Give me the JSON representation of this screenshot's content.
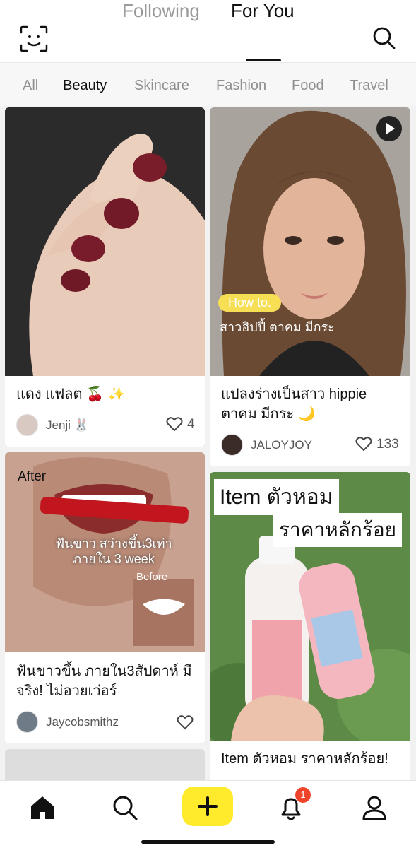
{
  "header": {
    "tabs": [
      {
        "label": "Following",
        "active": false
      },
      {
        "label": "For You",
        "active": true
      }
    ],
    "left_icon": "face-scan-icon",
    "right_icon": "search-icon"
  },
  "categories": [
    {
      "label": "All",
      "active": false
    },
    {
      "label": "Beauty",
      "active": true
    },
    {
      "label": "Skincare",
      "active": false
    },
    {
      "label": "Fashion",
      "active": false
    },
    {
      "label": "Food",
      "active": false
    },
    {
      "label": "Travel",
      "active": false
    }
  ],
  "feed": {
    "cards": [
      {
        "title": "แดง แฟลต 🍒 ✨",
        "author": "Jenji 🐰",
        "likes": "4",
        "thumb_color": "#d7b8a7"
      },
      {
        "title": "แปลงร่างเป็นสาว hippie ตาคม มีกระ 🌙",
        "author": "JALOYJOY",
        "likes": "133",
        "overlay_pill": "How to.",
        "overlay_text": "สาวฮิปปี้ ตาคม มีกระ",
        "thumb_color": "#7e5a44",
        "video": true
      },
      {
        "title": "ฟันขาวขึ้น ภายใน3สัปดาห์ มีจริง! ไม่อวยเว่อร์",
        "author": "Jaycobsmithz",
        "likes": "",
        "overlay_after": "After",
        "overlay_before": "Before",
        "overlay_text": "ฟันขาว สว่างขึ้น3เท่า ภายใน 3 week",
        "thumb_color": "#b78b7a"
      },
      {
        "title": "Item ตัวหอม ราคาหลักร้อย!",
        "overlay_line1": "Item ตัวหอม",
        "overlay_line2": "ราคาหลักร้อย",
        "thumb_color": "#6f9a57"
      }
    ]
  },
  "bottom_nav": {
    "items": [
      "home-icon",
      "search-icon",
      "create-plus-icon",
      "bell-icon",
      "profile-icon"
    ],
    "notification_count": "1",
    "accent": "#ffea2b"
  }
}
